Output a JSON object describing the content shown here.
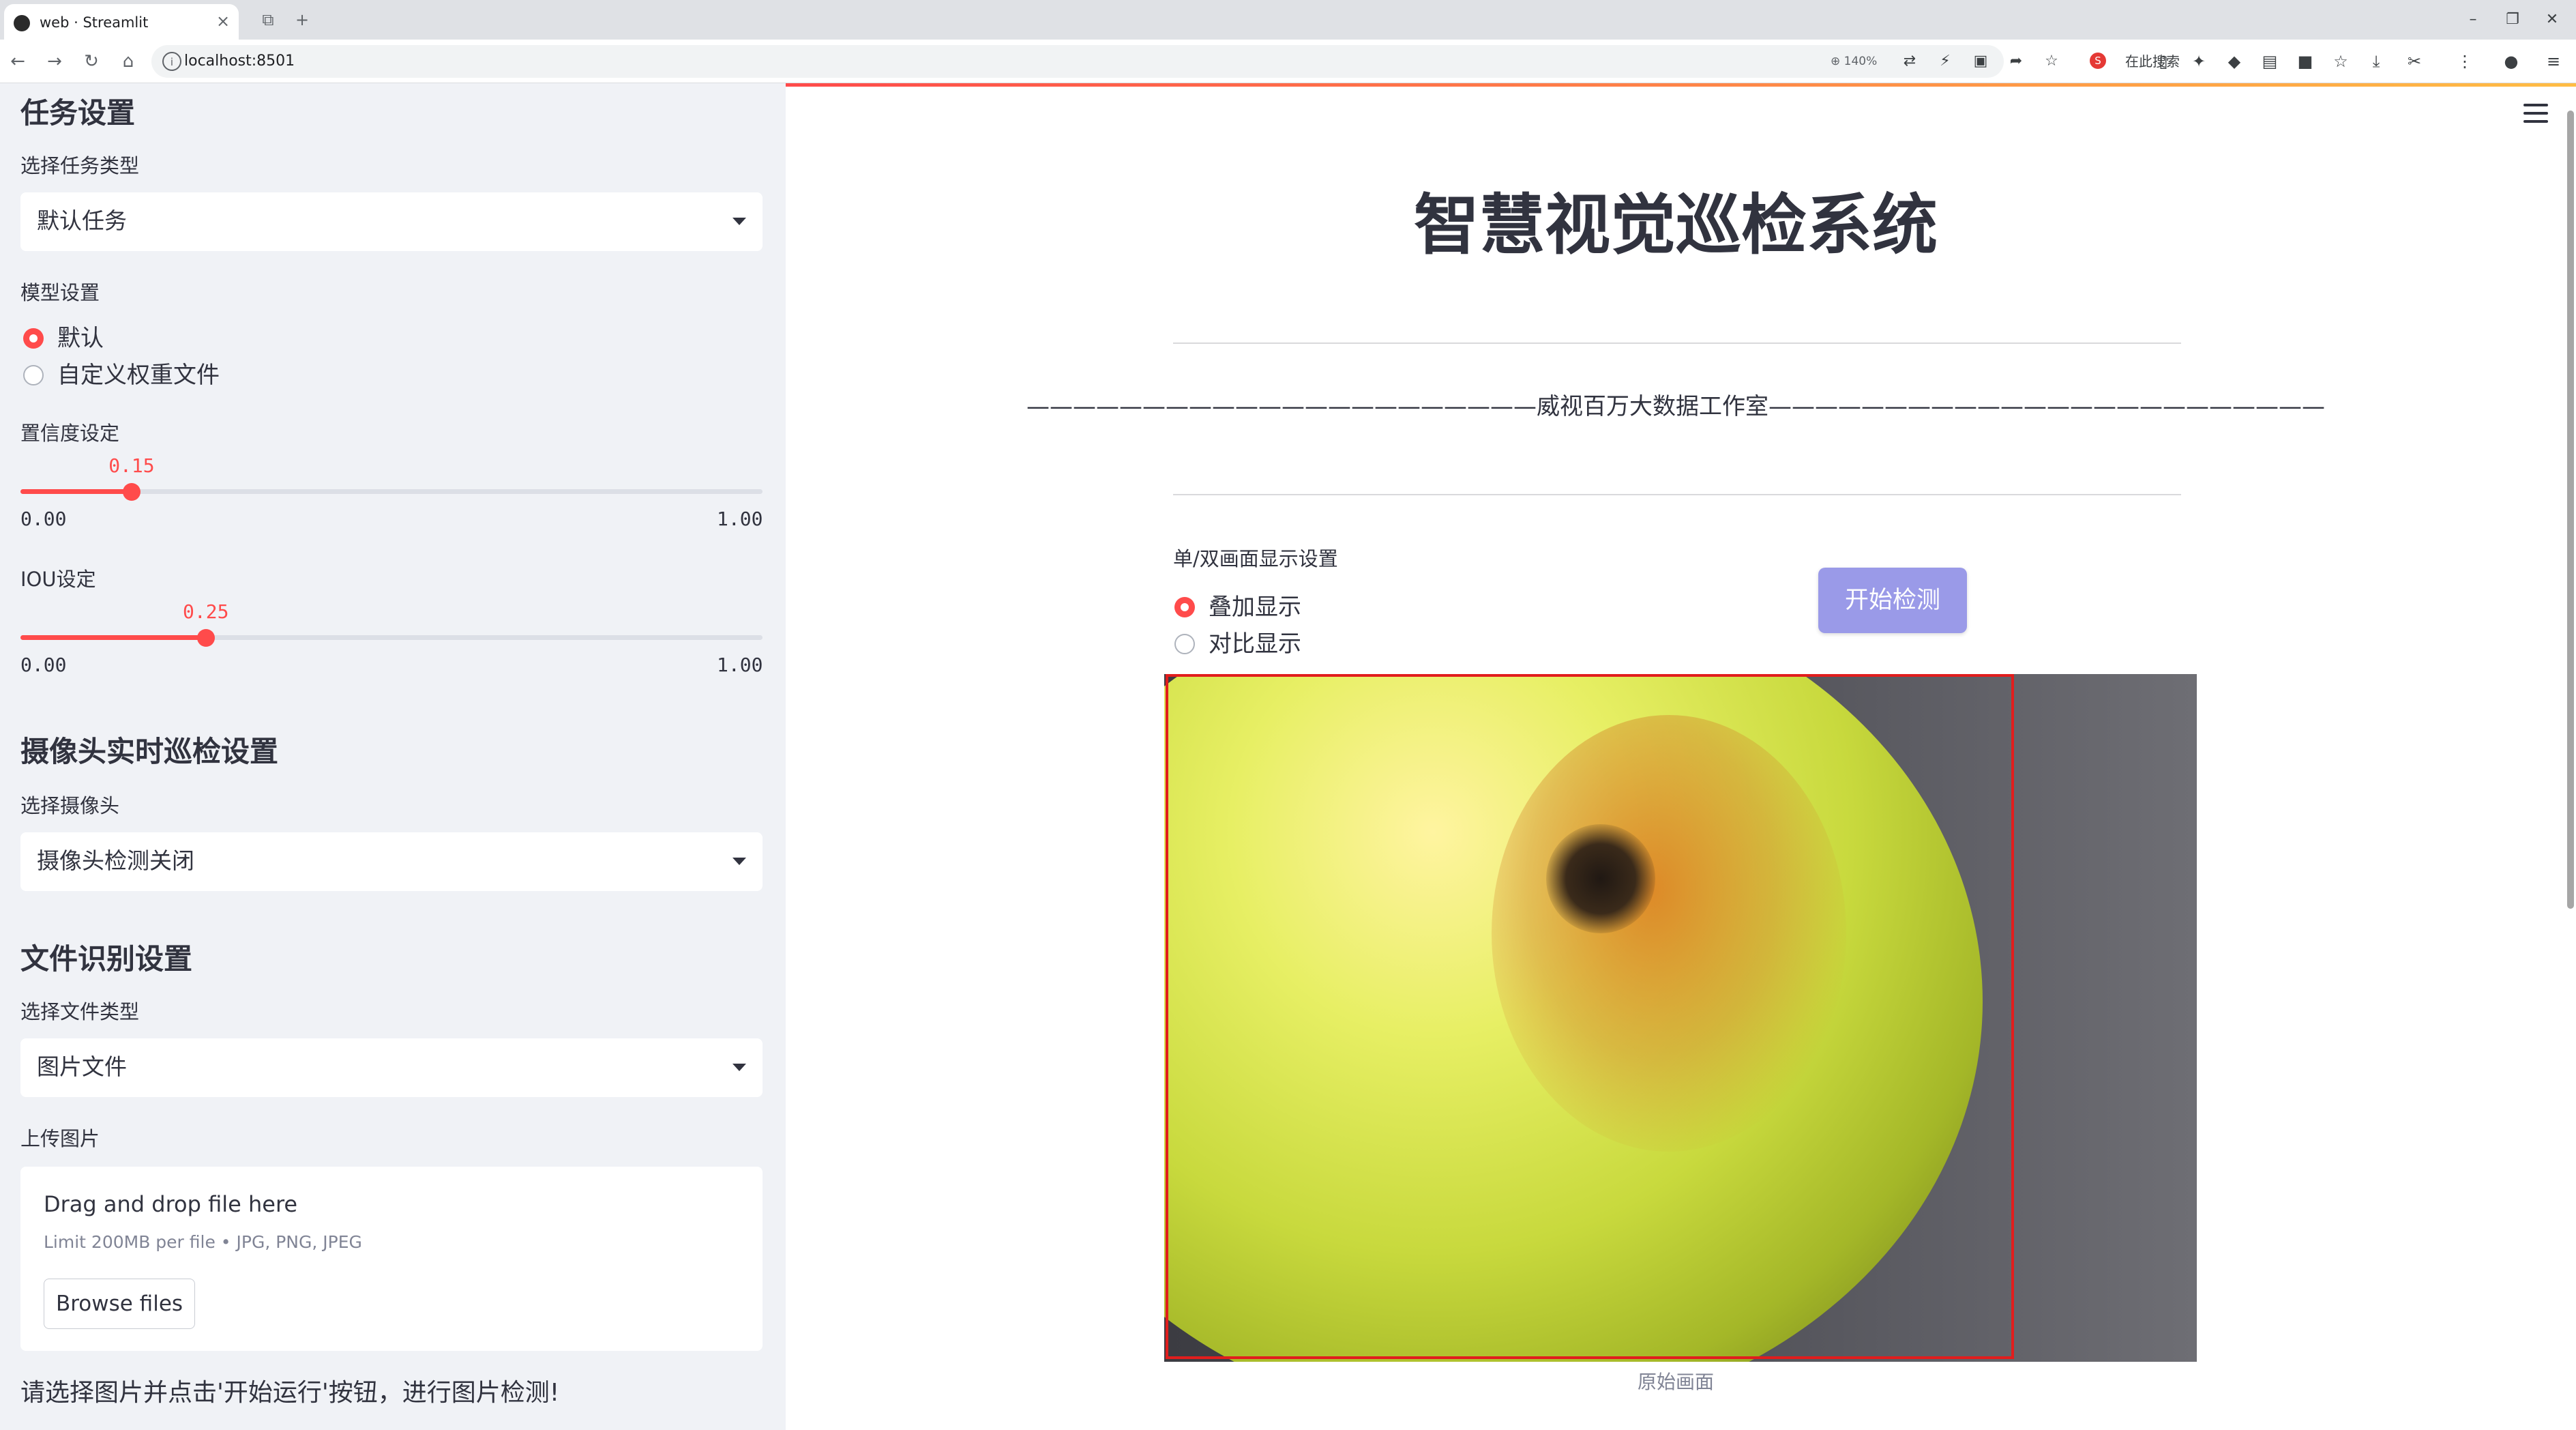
{
  "browser": {
    "tab_title": "web · Streamlit",
    "url": "localhost:8501",
    "zoom": "140%",
    "search_engine_label": "在此搜索",
    "search_engine_logo": "S"
  },
  "sidebar": {
    "task_section_title": "任务设置",
    "task_type_label": "选择任务类型",
    "task_type_value": "默认任务",
    "model_label": "模型设置",
    "model_options": [
      "默认",
      "自定义权重文件"
    ],
    "model_selected": "默认",
    "confidence_label": "置信度设定",
    "confidence": {
      "value": "0.15",
      "min": "0.00",
      "max": "1.00",
      "fraction": 0.15
    },
    "iou_label": "IOU设定",
    "iou": {
      "value": "0.25",
      "min": "0.00",
      "max": "1.00",
      "fraction": 0.25
    },
    "camera_section_title": "摄像头实时巡检设置",
    "camera_label": "选择摄像头",
    "camera_value": "摄像头检测关闭",
    "file_section_title": "文件识别设置",
    "file_type_label": "选择文件类型",
    "file_type_value": "图片文件",
    "upload_label": "上传图片",
    "upload_title": "Drag and drop file here",
    "upload_limit": "Limit 200MB per file • JPG, PNG, JPEG",
    "browse_label": "Browse files",
    "hint": "请选择图片并点击'开始运行'按钮，进行图片检测!"
  },
  "main": {
    "title": "智慧视觉巡检系统",
    "studio_line": "——————————————————————威视百万大数据工作室————————————————————————",
    "display_label": "单/双画面显示设置",
    "display_options": [
      "叠加显示",
      "对比显示"
    ],
    "display_selected": "叠加显示",
    "start_button": "开始检测",
    "image_caption": "原始画面"
  },
  "colors": {
    "accent": "#ff4b4b",
    "sidebar_bg": "#f0f2f6",
    "button_primary": "#9a9ae8",
    "detection_box": "#e11d1d"
  }
}
